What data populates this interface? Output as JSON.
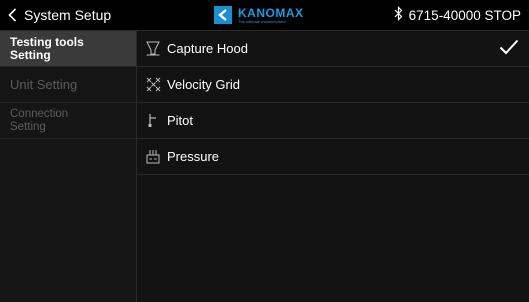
{
  "header": {
    "back_label": "System Setup",
    "brand": {
      "name": "KANOMAX",
      "tagline": "The ultimate measurement",
      "color": "#1b9be0",
      "icon": "kanomax-logo"
    },
    "status": {
      "bluetooth_icon": "bluetooth-icon",
      "device": "6715-40000 STOP"
    }
  },
  "sidebar": {
    "items": [
      {
        "label": "Testing tools Setting",
        "active": true
      },
      {
        "label": "Unit Setting",
        "active": false
      },
      {
        "label": "Connection Setting",
        "active": false
      }
    ]
  },
  "tools": {
    "items": [
      {
        "label": "Capture Hood",
        "icon": "capture-hood-icon",
        "selected": true
      },
      {
        "label": "Velocity Grid",
        "icon": "velocity-grid-icon",
        "selected": false
      },
      {
        "label": "Pitot",
        "icon": "pitot-icon",
        "selected": false
      },
      {
        "label": "Pressure",
        "icon": "pressure-icon",
        "selected": false
      }
    ]
  },
  "colors": {
    "accent": "#1b9be0",
    "active_row": "#3a3a3a",
    "background": "#121212"
  }
}
